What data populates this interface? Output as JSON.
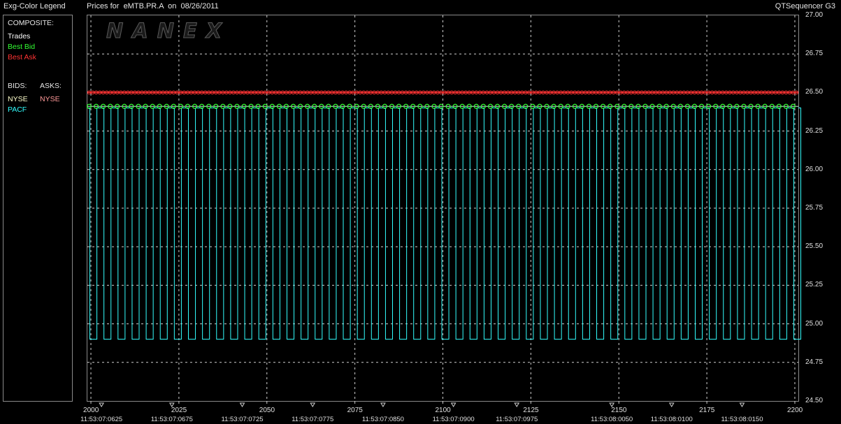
{
  "header": {
    "legend_title": "Exg-Color Legend",
    "chart_title": "Prices for  eMTB.PR.A  on  08/26/2011",
    "app_name": "QTSequencer G3"
  },
  "legend": {
    "composite_label": "COMPOSITE:",
    "composite_items": [
      {
        "label": "Trades",
        "color": "#ffffff"
      },
      {
        "label": "Best Bid",
        "color": "#33ff33"
      },
      {
        "label": "Best Ask",
        "color": "#ff3333"
      }
    ],
    "bids_label": "BIDS:",
    "asks_label": "ASKS:",
    "bids": [
      {
        "label": "NYSE",
        "color": "#ffffcc"
      },
      {
        "label": "PACF",
        "color": "#33ffff"
      }
    ],
    "asks": [
      {
        "label": "NYSE",
        "color": "#ff9999"
      }
    ]
  },
  "watermark": "NANEX",
  "chart_data": {
    "type": "line",
    "title": "Prices for  eMTB.PR.A  on  08/26/2011",
    "x_range": [
      1999,
      2201
    ],
    "ylim": [
      24.5,
      27.0
    ],
    "y_ticks": [
      "27.00",
      "26.75",
      "26.50",
      "26.25",
      "26.00",
      "25.75",
      "25.50",
      "25.25",
      "25.00",
      "24.75",
      "24.50"
    ],
    "x_ticks": [
      "2000",
      "2025",
      "2050",
      "2075",
      "2100",
      "2125",
      "2150",
      "2175",
      "2200"
    ],
    "time_ticks": [
      {
        "x": 2003,
        "label": "11:53:07:0625"
      },
      {
        "x": 2023,
        "label": "11:53:07:0675"
      },
      {
        "x": 2043,
        "label": "11:53:07:0725"
      },
      {
        "x": 2063,
        "label": "11:53:07:0775"
      },
      {
        "x": 2083,
        "label": "11:53:07:0850"
      },
      {
        "x": 2103,
        "label": "11:53:07:0900"
      },
      {
        "x": 2121,
        "label": "11:53:07:0975"
      },
      {
        "x": 2148,
        "label": "11:53:08:0050"
      },
      {
        "x": 2165,
        "label": "11:53:08:0100"
      },
      {
        "x": 2185,
        "label": "11:53:08:0150"
      }
    ],
    "grid": true,
    "series": [
      {
        "name": "Best Ask",
        "color": "#ff3333",
        "constant": 26.5
      },
      {
        "name": "Best Bid",
        "color": "#33ff33",
        "constant": 26.41
      },
      {
        "name": "PACF",
        "color": "#33ffff",
        "high": 26.4,
        "low": 24.9,
        "period": 4
      }
    ]
  }
}
